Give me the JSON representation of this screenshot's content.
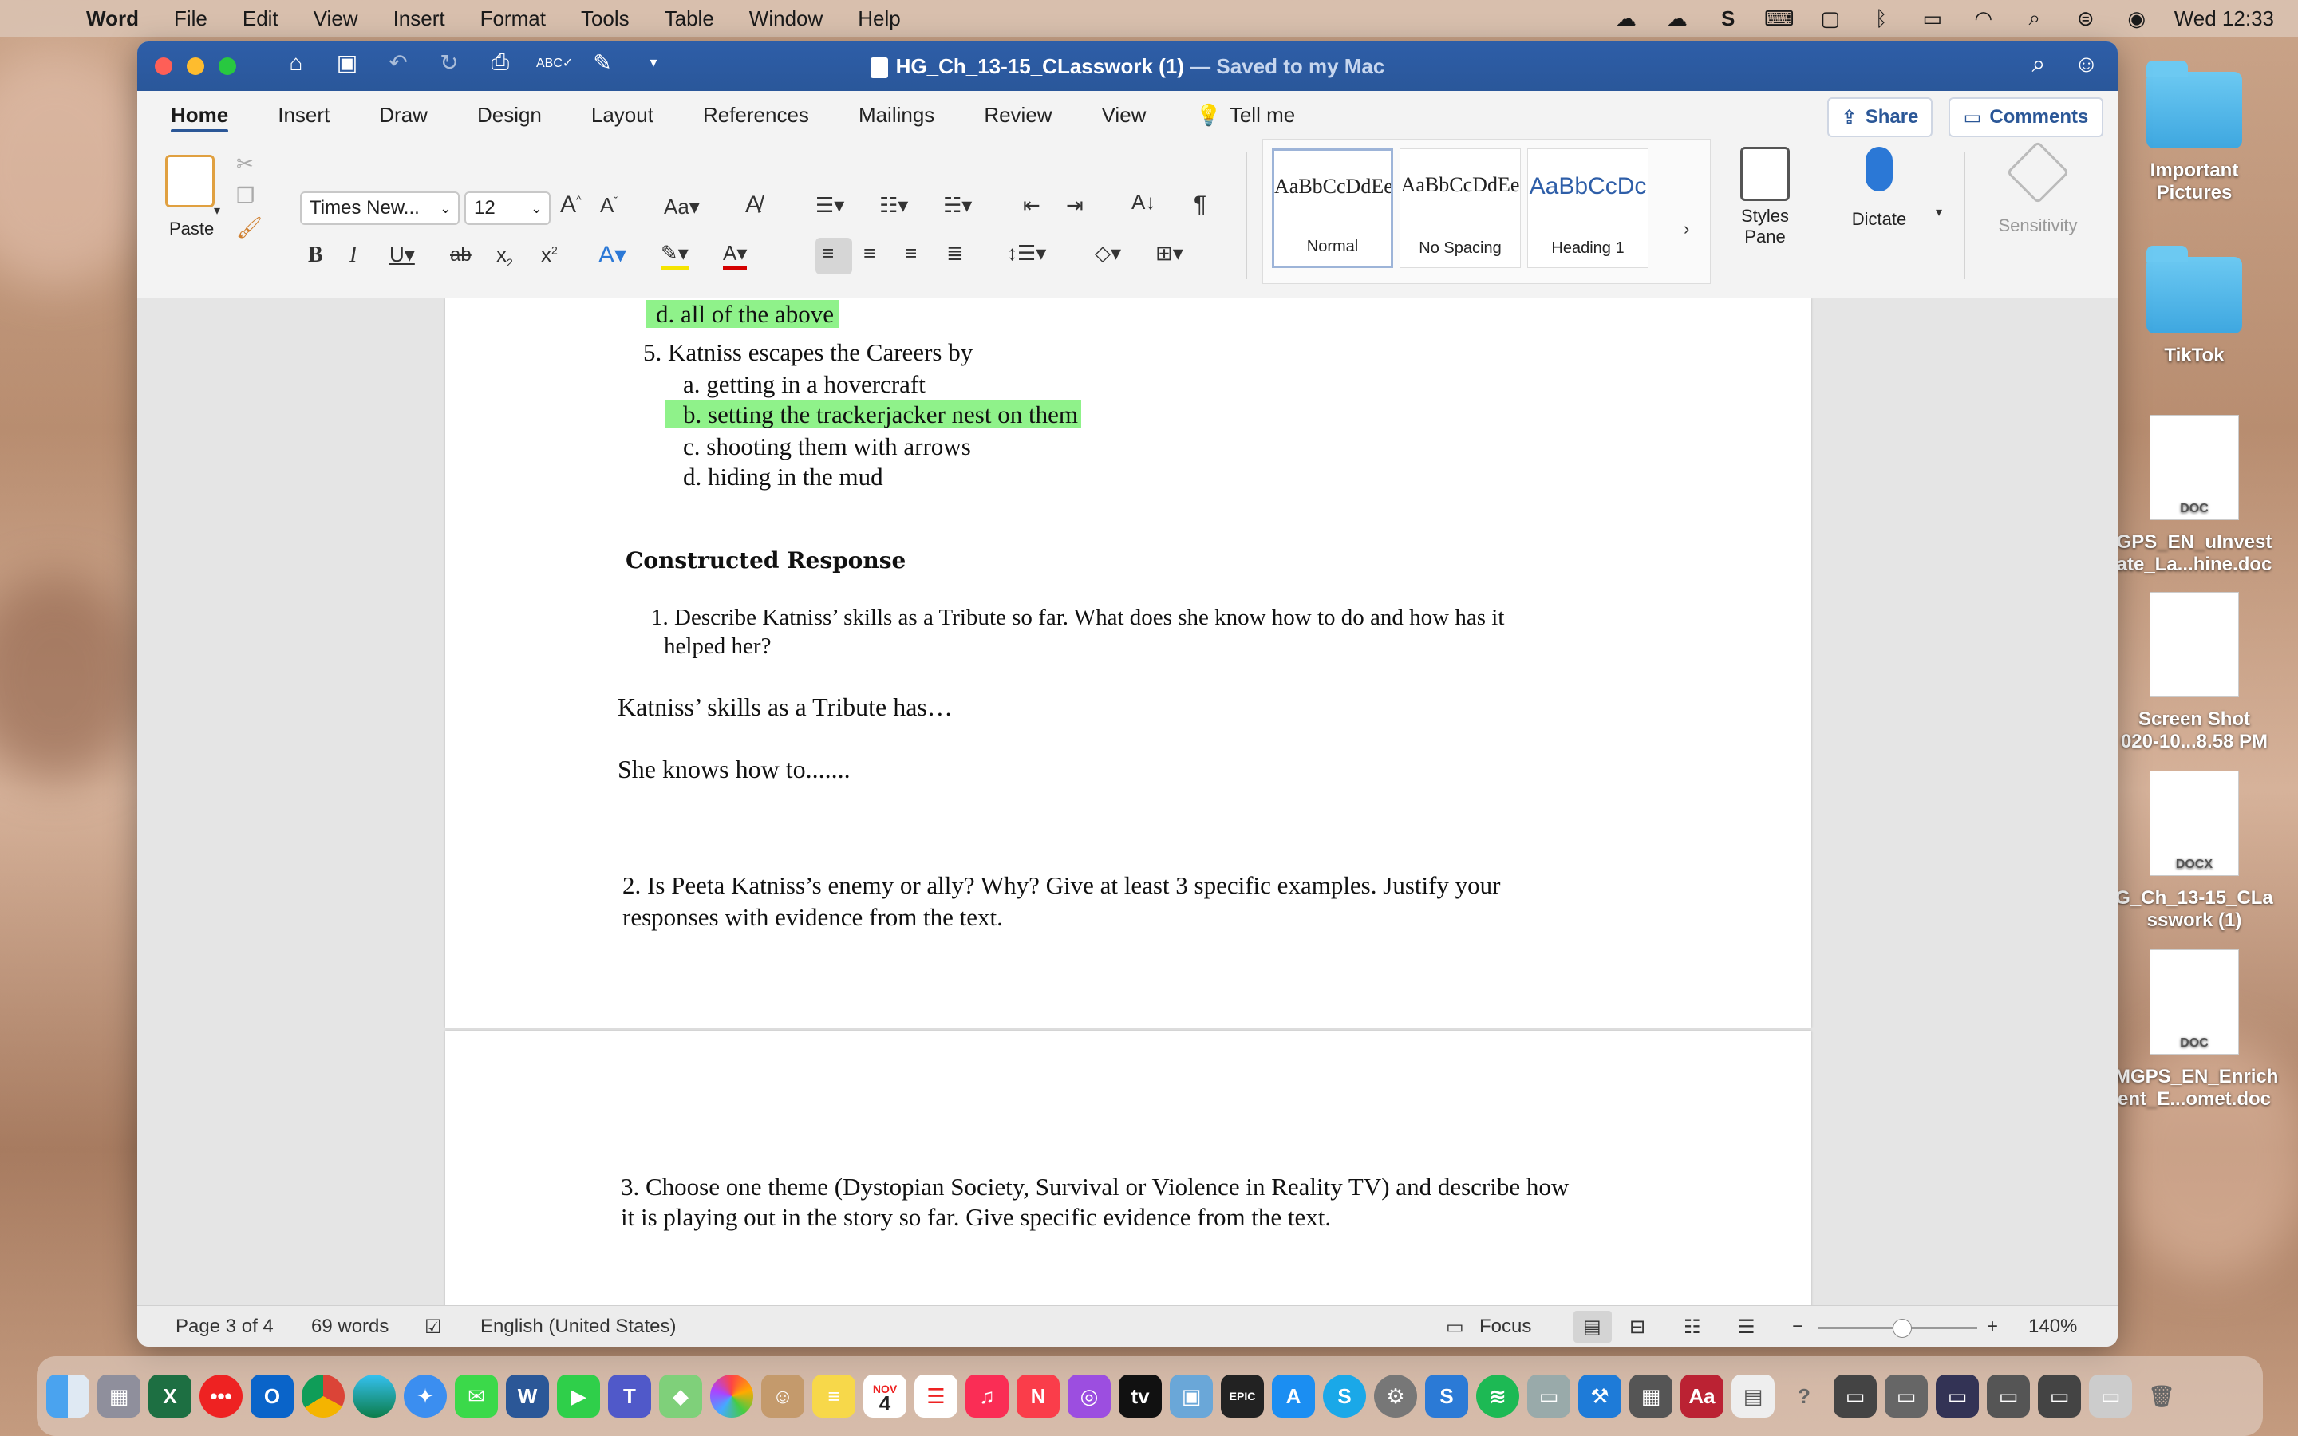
{
  "menubar": {
    "app": "Word",
    "items": [
      "File",
      "Edit",
      "View",
      "Insert",
      "Format",
      "Tools",
      "Table",
      "Window",
      "Help"
    ],
    "clock": "Wed 12:33"
  },
  "window": {
    "title": "HG_Ch_13-15_CLasswork (1)",
    "saved_status": "— Saved to my Mac"
  },
  "ribbon_tabs": [
    "Home",
    "Insert",
    "Draw",
    "Design",
    "Layout",
    "References",
    "Mailings",
    "Review",
    "View"
  ],
  "tell_me": "Tell me",
  "share_label": "Share",
  "comments_label": "Comments",
  "ribbon": {
    "paste": "Paste",
    "font_name": "Times New...",
    "font_size": "12",
    "styles": [
      {
        "preview": "AaBbCcDdEe",
        "name": "Normal"
      },
      {
        "preview": "AaBbCcDdEe",
        "name": "No Spacing"
      },
      {
        "preview": "AaBbCcDc",
        "name": "Heading 1"
      }
    ],
    "styles_pane": "Styles Pane",
    "dictate": "Dictate",
    "sensitivity": "Sensitivity"
  },
  "document": {
    "q4_d": "d.   all of the above",
    "q5": "5. Katniss escapes the Careers by",
    "q5_a": "a.   getting in a hovercraft",
    "q5_b": "b.   setting the trackerjacker nest on them",
    "q5_c": "c.   shooting them with arrows",
    "q5_d": "d.   hiding in the mud",
    "heading": "Constructed Response",
    "cr1_line1": "1. Describe Katniss’ skills as a Tribute so far. What does she know how to do and how has it",
    "cr1_line2": "helped her?",
    "ans1": "Katniss’ skills as a Tribute has…",
    "ans2": "She knows how to.......",
    "cr2_line1": "2. Is Peeta Katniss’s enemy or ally? Why? Give at least 3 specific examples. Justify your",
    "cr2_line2": "responses with evidence from the text.",
    "cr3_line1": "3. Choose one theme (Dystopian Society, Survival or Violence in Reality TV) and describe how",
    "cr3_line2": "it is playing out in the story so far. Give specific evidence from the text."
  },
  "status": {
    "page": "Page 3 of 4",
    "words": "69 words",
    "language": "English (United States)",
    "focus": "Focus",
    "zoom": "140%"
  },
  "desktop": {
    "icons": [
      {
        "label1": "Important",
        "label2": "Pictures"
      },
      {
        "label1": "TikTok",
        "label2": ""
      },
      {
        "label1": "GPS_EN_uInvest",
        "label2": "ate_La...hine.doc",
        "badge": "DOC"
      },
      {
        "label1": "Screen Shot",
        "label2": "020-10...8.58 PM"
      },
      {
        "label1": "G_Ch_13-15_CLa",
        "label2": "sswork (1)",
        "badge": "DOCX"
      },
      {
        "label1": "MGPS_EN_Enrich",
        "label2": "ent_E...omet.doc",
        "badge": "DOC"
      }
    ]
  },
  "dock": {
    "calendar_month": "NOV",
    "calendar_day": "4"
  }
}
